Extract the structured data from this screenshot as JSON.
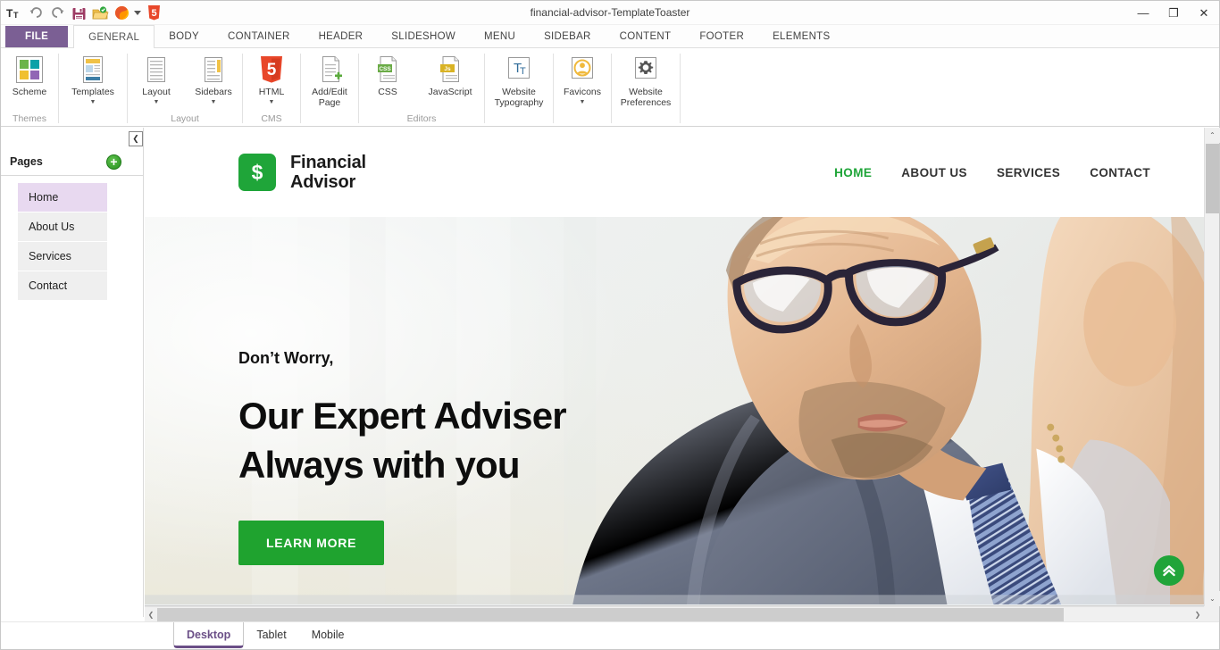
{
  "window": {
    "title": "financial-advisor-TemplateToaster",
    "minimize": "—",
    "maximize": "❐",
    "close": "✕",
    "help": "?"
  },
  "quick_access": [
    {
      "name": "font-size-icon",
      "glyph": "Tᴛ"
    },
    {
      "name": "undo-icon",
      "glyph": "↶"
    },
    {
      "name": "redo-icon",
      "glyph": "↷"
    },
    {
      "name": "save-icon",
      "glyph": "💾"
    },
    {
      "name": "export-icon",
      "glyph": "📂"
    },
    {
      "name": "preview-browser-icon",
      "glyph": "🦊"
    },
    {
      "name": "preview-dropdown-caret",
      "glyph": "▾"
    },
    {
      "name": "html5-icon",
      "glyph": "5"
    }
  ],
  "ribbon_tabs": [
    {
      "label": "FILE",
      "type": "file"
    },
    {
      "label": "GENERAL",
      "type": "active"
    },
    {
      "label": "BODY",
      "type": "normal"
    },
    {
      "label": "CONTAINER",
      "type": "normal"
    },
    {
      "label": "HEADER",
      "type": "normal"
    },
    {
      "label": "SLIDESHOW",
      "type": "normal"
    },
    {
      "label": "MENU",
      "type": "normal"
    },
    {
      "label": "SIDEBAR",
      "type": "normal"
    },
    {
      "label": "CONTENT",
      "type": "normal"
    },
    {
      "label": "FOOTER",
      "type": "normal"
    },
    {
      "label": "ELEMENTS",
      "type": "normal"
    }
  ],
  "ribbon_groups": [
    {
      "title": "Themes",
      "items": [
        {
          "label": "Scheme",
          "icon": "color-scheme-icon",
          "caret": ""
        }
      ]
    },
    {
      "title": "",
      "items": [
        {
          "label": "Templates",
          "icon": "templates-icon",
          "caret": "▼"
        }
      ]
    },
    {
      "title": "Layout",
      "items": [
        {
          "label": "Layout",
          "icon": "layout-icon",
          "caret": "▼"
        },
        {
          "label": "Sidebars",
          "icon": "sidebars-icon",
          "caret": "▼"
        }
      ]
    },
    {
      "title": "CMS",
      "items": [
        {
          "label": "HTML",
          "icon": "html5-shield-icon",
          "caret": "▼"
        }
      ]
    },
    {
      "title": "",
      "items": [
        {
          "label": "Add/Edit Page",
          "icon": "add-edit-page-icon",
          "caret": ""
        }
      ]
    },
    {
      "title": "Editors",
      "items": [
        {
          "label": "CSS",
          "icon": "css-file-icon",
          "caret": ""
        },
        {
          "label": "JavaScript",
          "icon": "js-file-icon",
          "caret": ""
        }
      ]
    },
    {
      "title": "",
      "items": [
        {
          "label": "Website Typography",
          "icon": "typography-icon",
          "caret": ""
        }
      ]
    },
    {
      "title": "",
      "items": [
        {
          "label": "Favicons",
          "icon": "favicon-icon",
          "caret": "▼"
        }
      ]
    },
    {
      "title": "",
      "items": [
        {
          "label": "Website Preferences",
          "icon": "gear-icon",
          "caret": ""
        }
      ]
    }
  ],
  "left_panel": {
    "collapse_glyph": "❮",
    "pages_title": "Pages",
    "add_glyph": "+",
    "pages": [
      {
        "label": "Home",
        "selected": true
      },
      {
        "label": "About Us",
        "selected": false
      },
      {
        "label": "Services",
        "selected": false
      },
      {
        "label": "Contact",
        "selected": false
      }
    ]
  },
  "preview": {
    "brand": {
      "logo_glyph": "$",
      "logo_color": "#1fa539",
      "line1": "Financial",
      "line2": "Advisor"
    },
    "nav": [
      {
        "label": "HOME",
        "active": true
      },
      {
        "label": "ABOUT US",
        "active": false
      },
      {
        "label": "SERVICES",
        "active": false
      },
      {
        "label": "CONTACT",
        "active": false
      }
    ],
    "hero": {
      "kicker": "Don’t Worry,",
      "title_line1": "Our Expert Adviser",
      "title_line2": "Always with you",
      "cta": "LEARN MORE",
      "cta_color": "#1fa32f",
      "scroll_top_glyph": "⏫"
    }
  },
  "scrollbars": {
    "v_up": "⌃",
    "v_down": "⌄",
    "h_left": "❮",
    "h_right": "❯"
  },
  "device_tabs": [
    {
      "label": "Desktop",
      "active": true
    },
    {
      "label": "Tablet",
      "active": false
    },
    {
      "label": "Mobile",
      "active": false
    }
  ]
}
